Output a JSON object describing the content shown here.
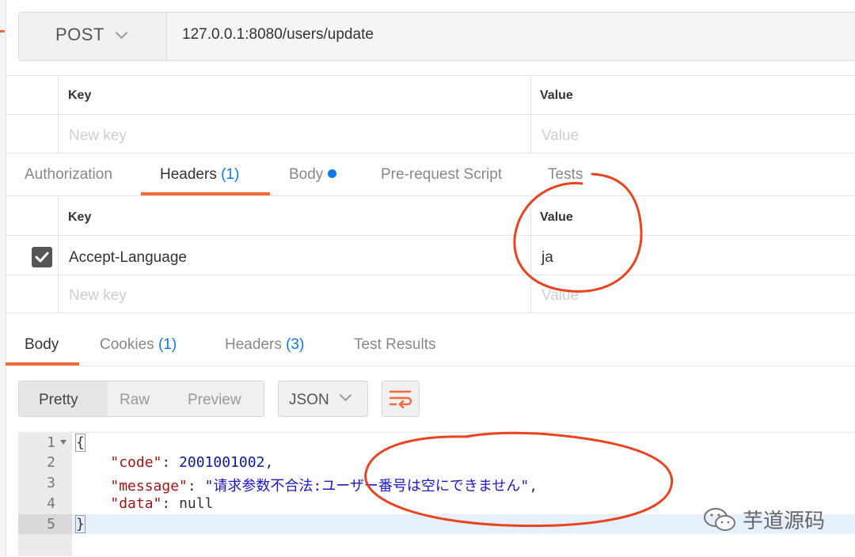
{
  "request": {
    "method": "POST",
    "url": "127.0.0.1:8080/users/update"
  },
  "params_table": {
    "key_header": "Key",
    "value_header": "Value",
    "key_placeholder": "New key",
    "value_placeholder": "Value"
  },
  "request_tabs": [
    {
      "label": "Authorization"
    },
    {
      "label": "Headers",
      "count": "(1)"
    },
    {
      "label": "Body"
    },
    {
      "label": "Pre-request Script"
    },
    {
      "label": "Tests"
    }
  ],
  "headers_table": {
    "key_header": "Key",
    "value_header": "Value",
    "row": {
      "key": "Accept-Language",
      "value": "ja",
      "checked": true
    },
    "key_placeholder": "New key",
    "value_placeholder": "Value"
  },
  "response_tabs": [
    {
      "label": "Body"
    },
    {
      "label": "Cookies",
      "count": "(1)"
    },
    {
      "label": "Headers",
      "count": "(3)"
    },
    {
      "label": "Test Results"
    }
  ],
  "view_modes": [
    "Pretty",
    "Raw",
    "Preview"
  ],
  "format": "JSON",
  "code": {
    "line_numbers": [
      "1",
      "2",
      "3",
      "4",
      "5"
    ],
    "open_brace": "{",
    "close_brace": "}",
    "code_key": "\"code\"",
    "code_value": "2001001002",
    "message_key": "\"message\"",
    "message_value": "\"请求参数不合法:ユーザー番号は空にできません\"",
    "data_key": "\"data\"",
    "data_value": "null"
  },
  "watermark": "芋道源码",
  "colors": {
    "accent": "#f26b3a",
    "link": "#097bed",
    "annotation": "#e8441f"
  }
}
